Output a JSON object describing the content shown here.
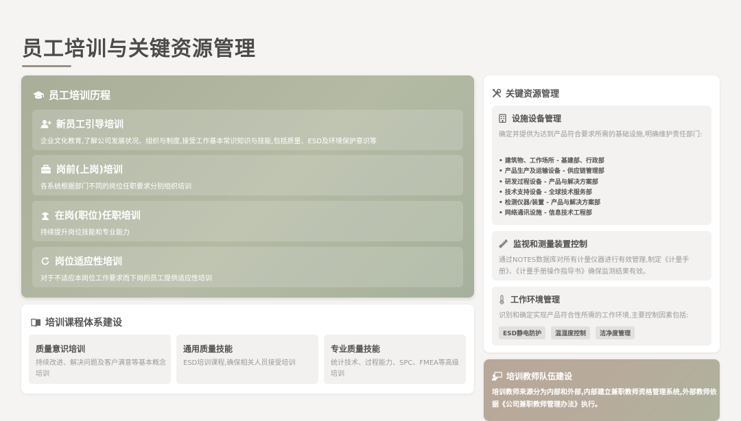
{
  "page": {
    "title": "员工培训与关键资源管理"
  },
  "training_history": {
    "heading": "员工培训历程",
    "items": [
      {
        "title": "新员工引导培训",
        "desc": "企业文化教育,了解公司发展状况、组织与制度,接受工作基本常识知识与技能,包括质量、ESD及环境保护意识等",
        "icon": "user-plus-icon"
      },
      {
        "title": "岗前(上岗)培训",
        "desc": "各系统根据部门不同的岗位任职要求分别组织培训",
        "icon": "briefcase-icon"
      },
      {
        "title": "在岗(职位)任职培训",
        "desc": "持续提升岗位技能和专业能力",
        "icon": "worker-icon"
      },
      {
        "title": "岗位适应性培训",
        "desc": "对于不适应本岗位工作要求而下岗的员工提供适应性培训",
        "icon": "refresh-icon"
      }
    ]
  },
  "curriculum": {
    "heading": "培训课程体系建设",
    "icon": "book-icon",
    "courses": [
      {
        "title": "质量意识培训",
        "desc": "持续改进、解决问题及客户满意等基本概念培训"
      },
      {
        "title": "通用质量技能",
        "desc": "ESD培训课程,确保相关人员接受培训"
      },
      {
        "title": "专业质量技能",
        "desc": "统计技术、过程能力、SPC、FMEA等高级培训"
      }
    ]
  },
  "resources": {
    "heading": "关键资源管理",
    "icon": "tools-icon",
    "facilities": {
      "title": "设施设备管理",
      "icon": "building-icon",
      "desc": "确定并提供为达到产品符合要求所需的基础设施,明确维护责任部门:",
      "list": [
        "建筑物、工作场所 - 基建部、行政部",
        "产品生产及运输设备 - 供应链管理部",
        "研发过程设备 - 产品与解决方案部",
        "技术支持设备 - 全球技术服务部",
        "检测仪器/装置 - 产品与解决方案部",
        "网络通讯设施 - 信息技术工程部"
      ]
    },
    "monitoring": {
      "title": "监视和测量装置控制",
      "icon": "ruler-icon",
      "desc": "通过NOTES数据库对所有计量仪器进行有效管理,制定《计量手册》、《计量手册操作指导书》确保监测结果有效。"
    },
    "environment": {
      "title": "工作环境管理",
      "icon": "thermometer-icon",
      "desc": "识别和确定实现产品符合性所需的工作环境,主要控制因素包括:",
      "tags": [
        "ESD静电防护",
        "温湿度控制",
        "洁净度管理"
      ]
    }
  },
  "teachers": {
    "heading": "培训教师队伍建设",
    "icon": "teacher-icon",
    "desc": "培训教师来源分为内部和外部,内部建立兼职教师资格管理系统,外部教师依据《公司兼职教师管理办法》执行。"
  }
}
